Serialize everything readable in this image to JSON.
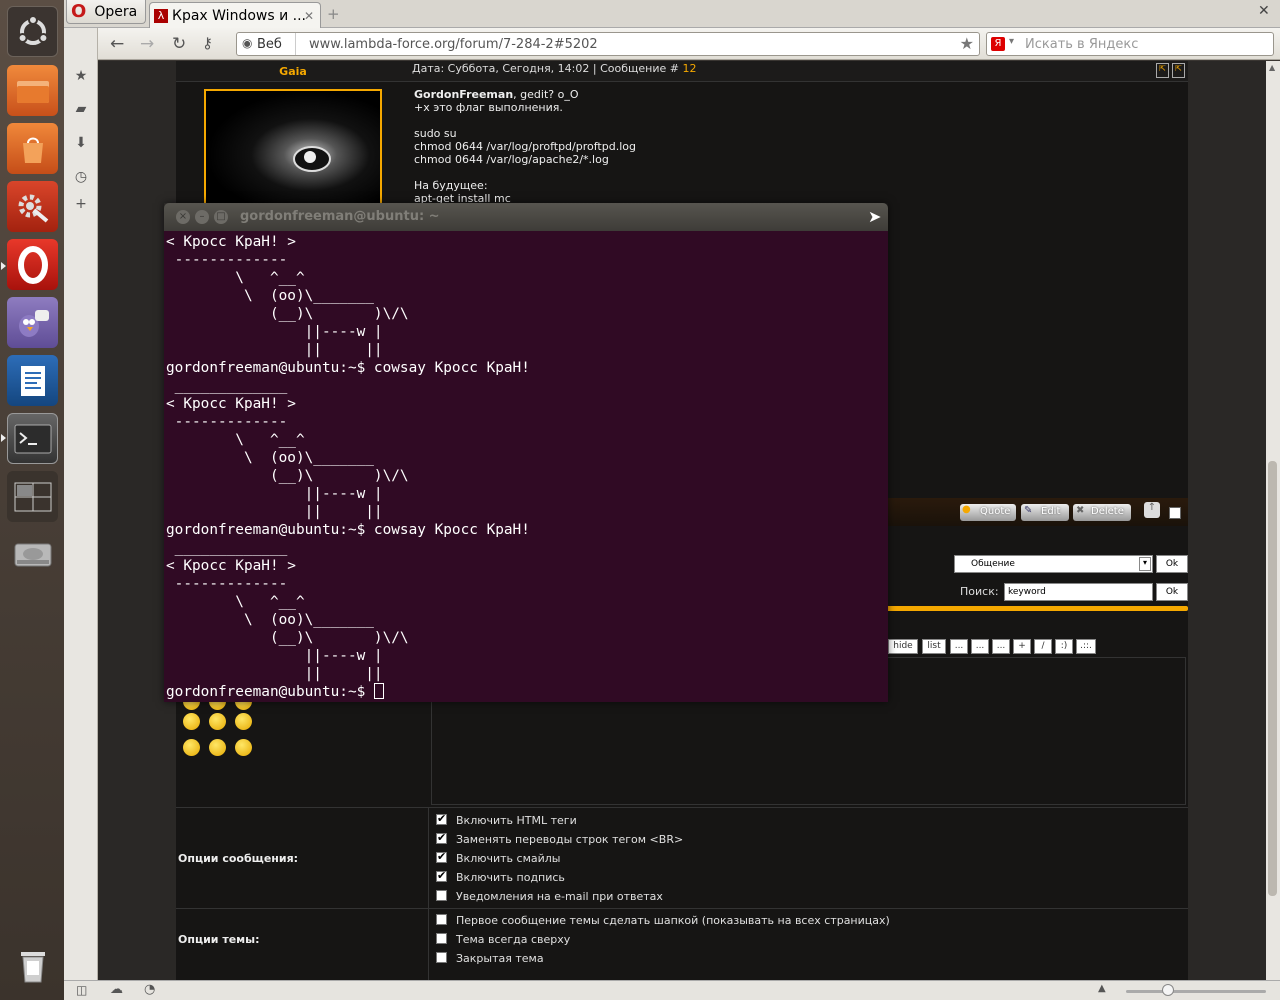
{
  "launcher": {
    "items": [
      "ubuntu-logo-icon",
      "home-folder-icon",
      "software-center-icon",
      "system-settings-icon",
      "opera-icon",
      "pidgin-icon",
      "libreoffice-writer-icon",
      "terminal-icon",
      "workspace-switcher-icon",
      "disk-drive-icon",
      "trash-icon"
    ]
  },
  "browser": {
    "menu_label": "Opera",
    "tab_title": "Крах Windows и ...",
    "web_badge": "Веб",
    "url": "www.lambda-force.org/forum/7-284-2#5202",
    "search_placeholder": "Искать в Яндекс"
  },
  "post": {
    "author": "Gaia",
    "meta_prefix": "Дата: Суббота, Сегодня, 14:02 | Сообщение #",
    "msg_number": "12",
    "lines": [
      {
        "bold": "GordonFreeman",
        "text": ", gedit? o_O"
      },
      {
        "bold": "",
        "text": "+x это флаг выполнения."
      },
      {
        "bold": "",
        "text": ""
      },
      {
        "bold": "",
        "text": "sudo su"
      },
      {
        "bold": "",
        "text": "chmod 0644 /var/log/proftpd/proftpd.log"
      },
      {
        "bold": "",
        "text": "chmod 0644 /var/log/apache2/*.log"
      },
      {
        "bold": "",
        "text": ""
      },
      {
        "bold": "",
        "text": "На будущее:"
      },
      {
        "bold": "",
        "text": "apt-get install mc"
      }
    ],
    "quote_label": "Quote",
    "edit_label": "Edit",
    "delete_label": "Delete"
  },
  "forum_nav": {
    "jump_value": "Общение",
    "ok_label": "Ok",
    "search_label": "Поиск:",
    "search_value": "keyword"
  },
  "editor": {
    "toolbar": [
      "hide",
      "list",
      "...",
      "...",
      "...",
      "+",
      "/",
      ":)",
      ".::."
    ]
  },
  "message_options": {
    "label": "Опции сообщения:",
    "items": [
      {
        "text": "Включить HTML теги",
        "checked": true
      },
      {
        "text": "Заменять переводы строк тегом <BR>",
        "checked": true
      },
      {
        "text": "Включить смайлы",
        "checked": true
      },
      {
        "text": "Включить подпись",
        "checked": true
      },
      {
        "text": "Уведомления на e-mail при ответах",
        "checked": false
      }
    ]
  },
  "topic_options": {
    "label": "Опции темы:",
    "items": [
      {
        "text": "Первое сообщение темы сделать шапкой (показывать на всех страницах)",
        "checked": false
      },
      {
        "text": "Тема всегда сверху",
        "checked": false
      },
      {
        "text": "Закрытая тема",
        "checked": false
      }
    ]
  },
  "terminal": {
    "title": "gordonfreeman@ubuntu: ~",
    "lines": [
      "< Кросс КраН! >",
      " -------------",
      "        \\   ^__^",
      "         \\  (oo)\\_______",
      "            (__)\\       )\\/\\",
      "                ||----w |",
      "                ||     ||",
      "gordonfreeman@ubuntu:~$ cowsay Кросс КраН!",
      " _____________",
      "< Кросс КраН! >",
      " -------------",
      "        \\   ^__^",
      "         \\  (oo)\\_______",
      "            (__)\\       )\\/\\",
      "                ||----w |",
      "                ||     ||",
      "gordonfreeman@ubuntu:~$ cowsay Кросс КраН!",
      " _____________",
      "< Кросс КраН! >",
      " -------------",
      "        \\   ^__^",
      "         \\  (oo)\\_______",
      "            (__)\\       )\\/\\",
      "                ||----w |",
      "                ||     ||"
    ],
    "prompt": "gordonfreeman@ubuntu:~$ "
  },
  "colors": {
    "terminal_bg": "#300a24",
    "forum_accent": "#f5a800"
  }
}
